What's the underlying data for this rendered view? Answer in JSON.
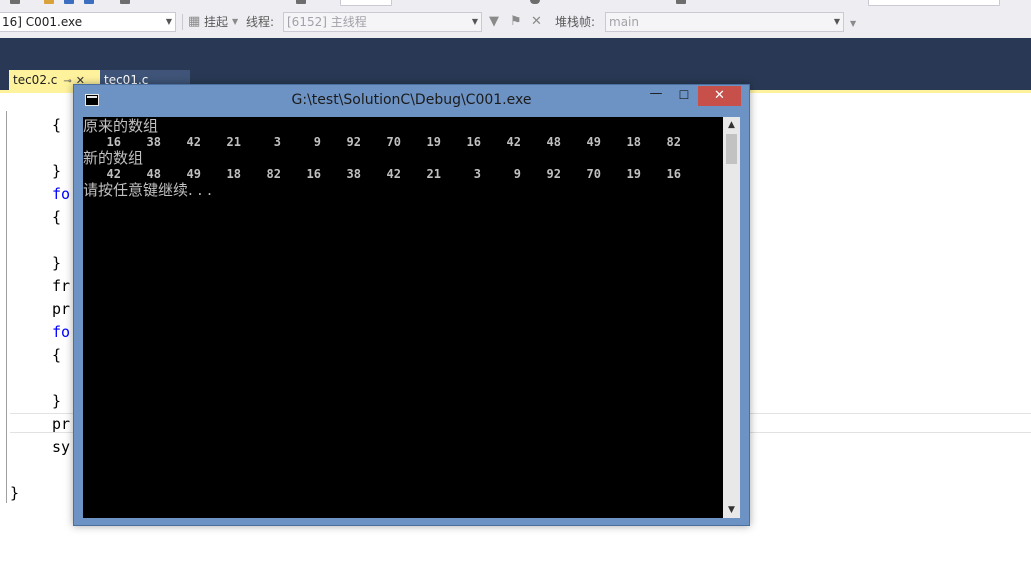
{
  "toolbar": {
    "process_value": "16] C001.exe",
    "suspend_label": "挂起",
    "thread_label": "线程:",
    "thread_value": "[6152] 主线程",
    "stack_frame_label": "堆栈帧:",
    "stack_frame_value": "main"
  },
  "tabs": [
    {
      "label": "tec02.c",
      "active": true
    },
    {
      "label": "tec01.c",
      "active": false
    }
  ],
  "code_lines": [
    "{",
    "}",
    "fo",
    "{",
    "}",
    "fr",
    "pr",
    "fo",
    "{",
    "}",
    "pr",
    "sy",
    "}"
  ],
  "console": {
    "title": "G:\\test\\SolutionC\\Debug\\C001.exe",
    "original_label": "原来的数组",
    "original_values": [
      16,
      38,
      42,
      21,
      3,
      9,
      92,
      70,
      19,
      16,
      42,
      48,
      49,
      18,
      82
    ],
    "new_label": "新的数组",
    "new_values": [
      42,
      48,
      49,
      18,
      82,
      16,
      38,
      42,
      21,
      3,
      9,
      92,
      70,
      19,
      16
    ],
    "prompt": "请按任意键继续. . .",
    "minimize_glyph": "—",
    "maximize_glyph": "☐",
    "close_glyph": "✕"
  },
  "icons": [
    "window-app-icon",
    "funnel-icon",
    "thread-flag-icon",
    "chevron-down-icon"
  ]
}
